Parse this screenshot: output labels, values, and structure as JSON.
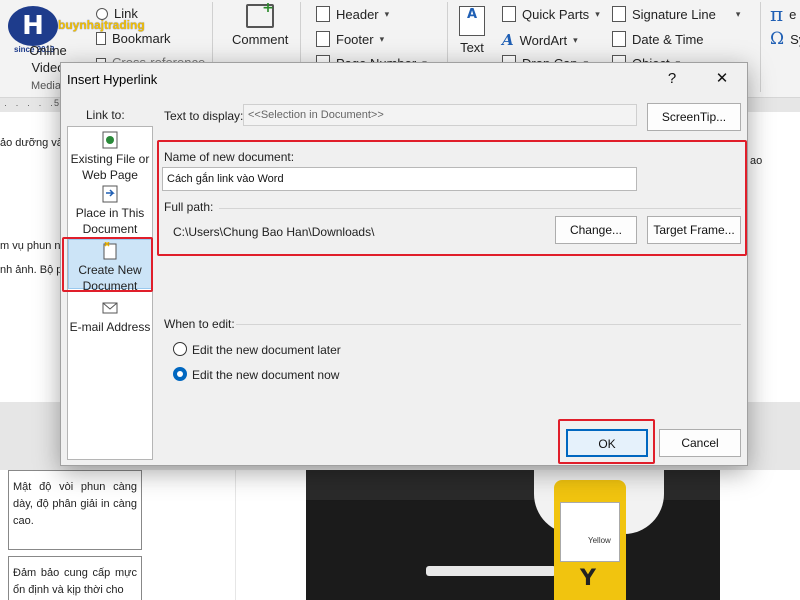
{
  "ribbon": {
    "logo": {
      "name": "buynhajtrading",
      "since": "since 2013"
    },
    "link": "Link",
    "bookmark": "Bookmark",
    "online_video": "Online Video",
    "media": "Media",
    "cross_reference": "Cross-reference",
    "comment": "Comment",
    "header": "Header",
    "footer": "Footer",
    "page_number": "Page Number",
    "text": "Text",
    "quick_parts": "Quick Parts",
    "wordart": "WordArt",
    "drop_cap": "Drop Cap",
    "signature_line": "Signature Line",
    "date_time": "Date & Time",
    "object": "Object",
    "equation_symbol": "π",
    "symbol_glyph": "Ω",
    "symbol_cut": "Sy"
  },
  "document": {
    "ruler_mark": "5",
    "line1": "ảo dưỡng và",
    "line2": "m vụ phun n",
    "line3": "nh ảnh. Bộ ph",
    "right_text": "ao",
    "table_cell1": "Mật độ vòi phun càng dày, độ phân giải in càng cao.",
    "table_cell2": "Đảm bảo cung cấp mực ổn định và kịp thời cho",
    "photo": {
      "bottle_label": "Yellow",
      "bottle_letter": "Y"
    }
  },
  "dialog": {
    "title": "Insert Hyperlink",
    "help": "?",
    "close": "✕",
    "link_to_label": "Link to:",
    "link_to_items": [
      {
        "label": "Existing File or Web Page",
        "icon": "web-page-icon"
      },
      {
        "label": "Place in This Document",
        "icon": "place-in-document-icon"
      },
      {
        "label": "Create New Document",
        "icon": "new-document-icon"
      },
      {
        "label": "E-mail Address",
        "icon": "email-icon"
      }
    ],
    "text_to_display_label": "Text to display:",
    "text_to_display_value": "<<Selection in Document>>",
    "screentip_button": "ScreenTip...",
    "name_label": "Name of new document:",
    "name_value": "Cách gắn link vào Word",
    "full_path_label": "Full path:",
    "full_path_value": "C:\\Users\\Chung Bao Han\\Downloads\\",
    "change_button": "Change...",
    "target_frame_button": "Target Frame...",
    "when_to_edit_label": "When to edit:",
    "edit_later": "Edit the new document later",
    "edit_now": "Edit the new document now",
    "selected_edit_option": "edit_now",
    "ok_button": "OK",
    "cancel_button": "Cancel"
  },
  "colors": {
    "highlight": "#e01e2a",
    "selection": "#cce4f7",
    "accent": "#0067c0",
    "brand_blue": "#1e3c8c",
    "brand_yellow": "#f5c000"
  }
}
